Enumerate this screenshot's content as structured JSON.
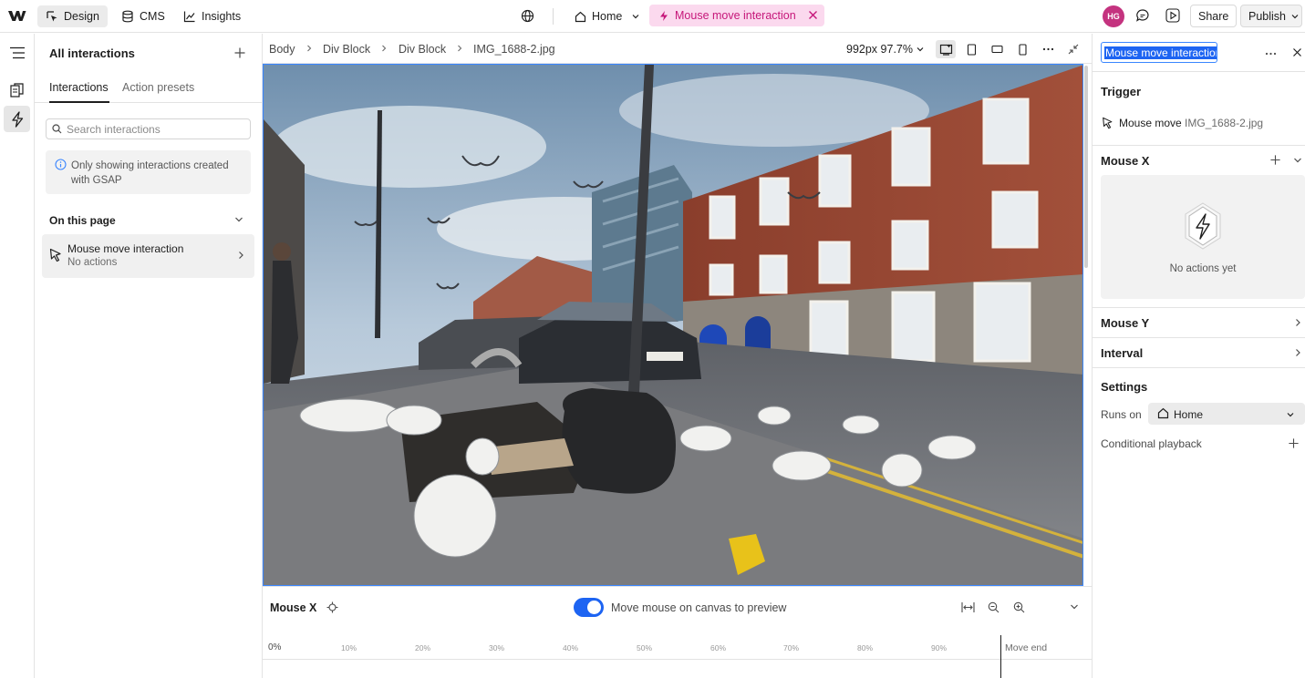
{
  "topbar": {
    "design_label": "Design",
    "cms_label": "CMS",
    "insights_label": "Insights",
    "page_label": "Home",
    "mode_label": "Mouse move interaction",
    "avatar_initials": "HG",
    "share_label": "Share",
    "publish_label": "Publish"
  },
  "left_panel": {
    "title": "All interactions",
    "tabs": [
      "Interactions",
      "Action presets"
    ],
    "search_placeholder": "Search interactions",
    "notice": "Only showing interactions created with GSAP",
    "section_title": "On this page",
    "items": [
      {
        "name": "Mouse move interaction",
        "subtitle": "No actions"
      }
    ]
  },
  "breadcrumb": [
    "Body",
    "Div Block",
    "Div Block",
    "IMG_1688-2.jpg"
  ],
  "viewport": {
    "width_label": "992px",
    "zoom_label": "97.7%"
  },
  "timeline": {
    "title": "Mouse X",
    "preview_label": "Move mouse on canvas to preview",
    "preview_on": true,
    "ticks": [
      "0%",
      "10%",
      "20%",
      "30%",
      "40%",
      "50%",
      "60%",
      "70%",
      "80%",
      "90%"
    ],
    "end_label": "Move end"
  },
  "right_panel": {
    "name_value": "Mouse move interaction",
    "trigger_header": "Trigger",
    "trigger_event": "Mouse move",
    "trigger_target": "IMG_1688-2.jpg",
    "mouse_x_header": "Mouse X",
    "empty_state": "No actions yet",
    "mouse_y_header": "Mouse Y",
    "interval_header": "Interval",
    "settings_header": "Settings",
    "runs_on_label": "Runs on",
    "runs_on_value": "Home",
    "conditional_label": "Conditional playback"
  },
  "colors": {
    "accent": "#1d64f2",
    "interaction_pink": "#c6177a",
    "interaction_pink_bg": "#fbd9ee",
    "selection_blue": "#3a86ff",
    "avatar": "#c4337f"
  },
  "icons": [
    "webflow-logo-icon",
    "design-icon",
    "cms-icon",
    "insights-icon",
    "globe-icon",
    "home-icon",
    "lightning-icon",
    "close-icon",
    "comment-icon",
    "play-icon",
    "chevron-down-icon",
    "navigator-icon",
    "pages-icon",
    "interactions-icon",
    "plus-icon",
    "search-icon",
    "info-icon",
    "cursor-icon",
    "chevron-right-icon",
    "desktop-icon",
    "tablet-icon",
    "mobile-landscape-icon",
    "mobile-icon",
    "more-icon",
    "collapse-icon",
    "target-icon",
    "fit-icon",
    "zoom-out-icon",
    "zoom-in-icon"
  ]
}
